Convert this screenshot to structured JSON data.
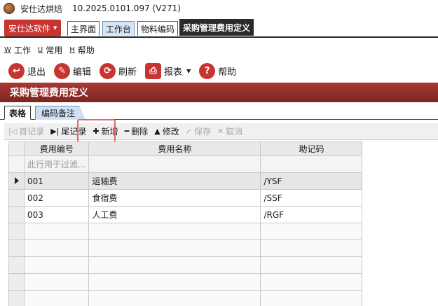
{
  "window": {
    "app_name": "安仕达烘焙",
    "version": "10.2025.0101.097 (V271)"
  },
  "tabstrip": {
    "app_menu_label": "安仕达软件",
    "tabs": [
      {
        "label": "主界面"
      },
      {
        "label": "工作台"
      },
      {
        "label": "物料编码"
      },
      {
        "label": "采购管理费用定义"
      }
    ]
  },
  "menubar": {
    "items": [
      {
        "key": "W",
        "label": "工作"
      },
      {
        "key": "U",
        "label": "常用"
      },
      {
        "key": "H",
        "label": "帮助"
      }
    ]
  },
  "toolbar": {
    "exit_label": "退出",
    "edit_label": "编辑",
    "refresh_label": "刷新",
    "report_label": "报表",
    "help_label": "帮助"
  },
  "header": {
    "title": "采购管理费用定义"
  },
  "subtabs": [
    {
      "label": "表格"
    },
    {
      "label": "编码备注"
    }
  ],
  "gridtoolbar": {
    "first_label": "首记录",
    "last_label": "尾记录",
    "add_label": "新增",
    "delete_label": "删除",
    "modify_label": "修改",
    "save_label": "保存",
    "cancel_label": "取消"
  },
  "grid": {
    "columns": [
      "费用编号",
      "费用名称",
      "助记码"
    ],
    "filter_placeholder": "此行用于过滤...",
    "rows": [
      {
        "code": "001",
        "name": "运输费",
        "mnemonic": "/YSF"
      },
      {
        "code": "002",
        "name": "食宿费",
        "mnemonic": "/SSF"
      },
      {
        "code": "003",
        "name": "人工费",
        "mnemonic": "/RGF"
      }
    ]
  },
  "colors": {
    "accent_red": "#c8342f",
    "header_band": "#8f2b27",
    "highlight": "#e8636b"
  }
}
